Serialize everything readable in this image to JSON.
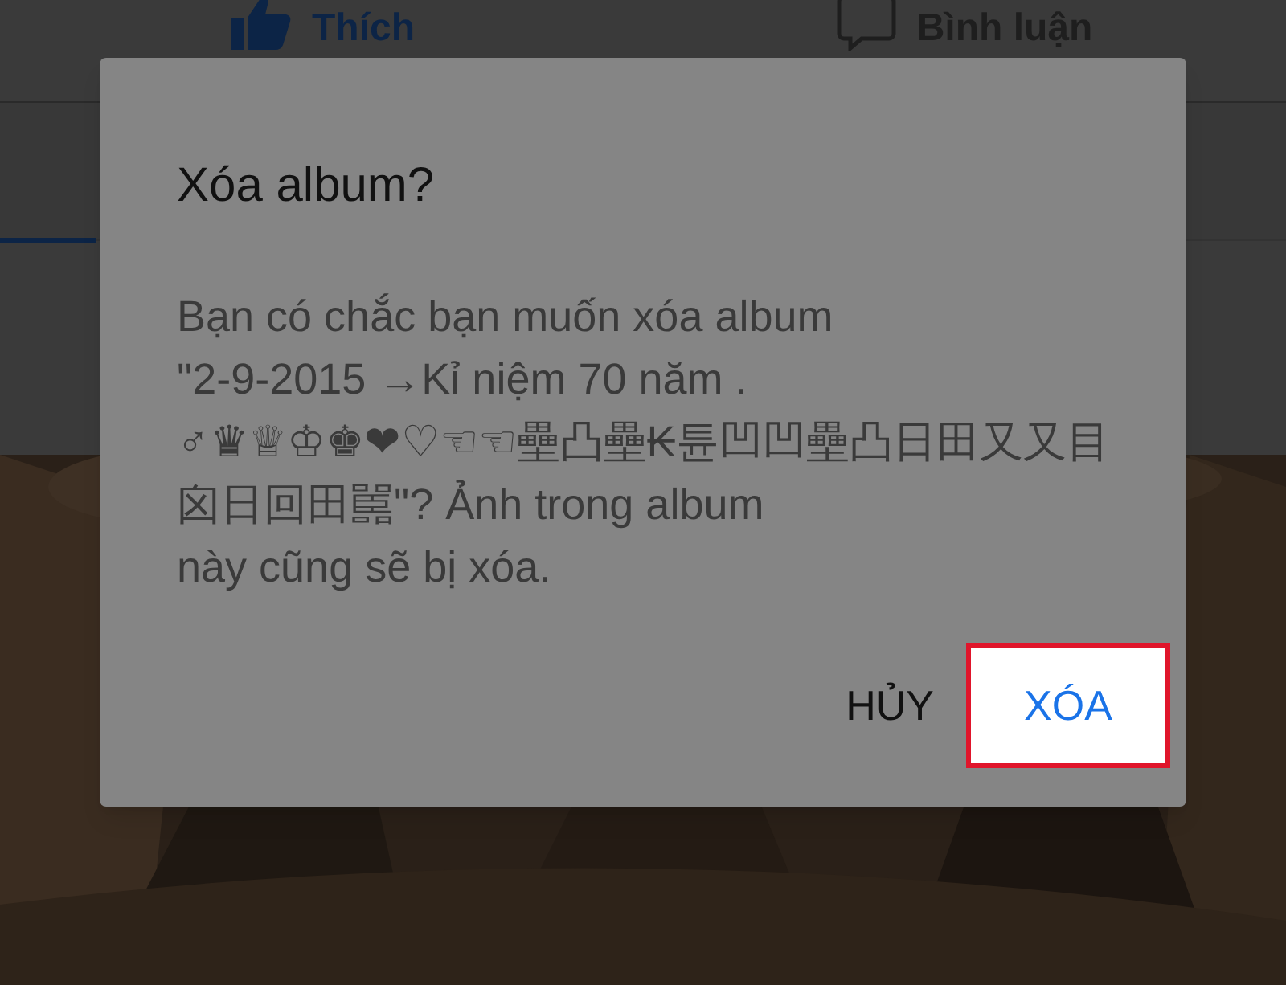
{
  "tabs": [
    {
      "label": "Thích",
      "kind": "like",
      "selected": true
    },
    {
      "label": "Bình luận",
      "kind": "comment",
      "selected": false
    }
  ],
  "dialog": {
    "title": "Xóa album?",
    "message": "Bạn có chắc bạn muốn xóa album\n\"2-9-2015 →Kỉ niệm 70 năm .\n♂♛♕♔♚❤♡☜☜壘凸壘₭튠凹凹壘凸日田又又目囟日回田嚚\"? Ảnh trong album\nnày cũng sẽ bị xóa.",
    "buttons": [
      {
        "label": "HỦY",
        "highlighted": false
      },
      {
        "label": "XÓA",
        "highlighted": true
      }
    ]
  }
}
